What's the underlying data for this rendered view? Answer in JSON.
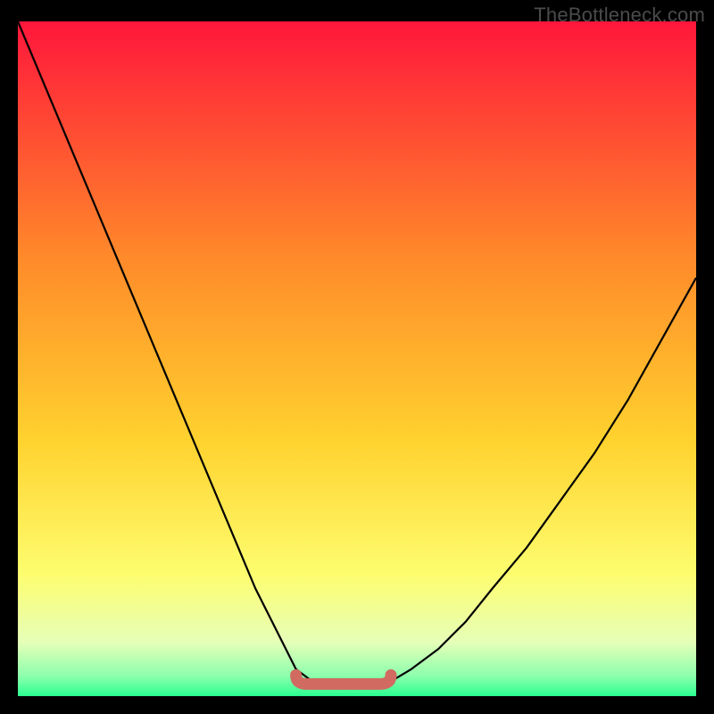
{
  "watermark": "TheBottleneck.com",
  "colors": {
    "background": "#000000",
    "gradient_top": "#ff163b",
    "gradient_mid1": "#ff6a2c",
    "gradient_mid2": "#ffd22e",
    "gradient_mid3": "#fdfd6f",
    "gradient_bottom_pale": "#ccffb4",
    "gradient_bottom_green": "#2bff8f",
    "curve": "#000000",
    "marker": "#d16a60"
  },
  "chart_data": {
    "type": "line",
    "title": "",
    "xlabel": "",
    "ylabel": "",
    "x": [
      0.0,
      0.05,
      0.1,
      0.15,
      0.2,
      0.25,
      0.3,
      0.35,
      0.4,
      0.41,
      0.43,
      0.45,
      0.47,
      0.49,
      0.51,
      0.53,
      0.55,
      0.58,
      0.62,
      0.66,
      0.7,
      0.75,
      0.8,
      0.85,
      0.9,
      0.95,
      1.0
    ],
    "values": [
      1.0,
      0.88,
      0.76,
      0.64,
      0.52,
      0.4,
      0.28,
      0.16,
      0.06,
      0.04,
      0.025,
      0.018,
      0.016,
      0.016,
      0.016,
      0.018,
      0.022,
      0.04,
      0.07,
      0.11,
      0.16,
      0.22,
      0.29,
      0.36,
      0.44,
      0.53,
      0.62
    ],
    "xlim": [
      0,
      1
    ],
    "ylim": [
      0,
      1
    ],
    "marker_region": {
      "x_start": 0.41,
      "x_end": 0.55,
      "y": 0.018
    }
  }
}
